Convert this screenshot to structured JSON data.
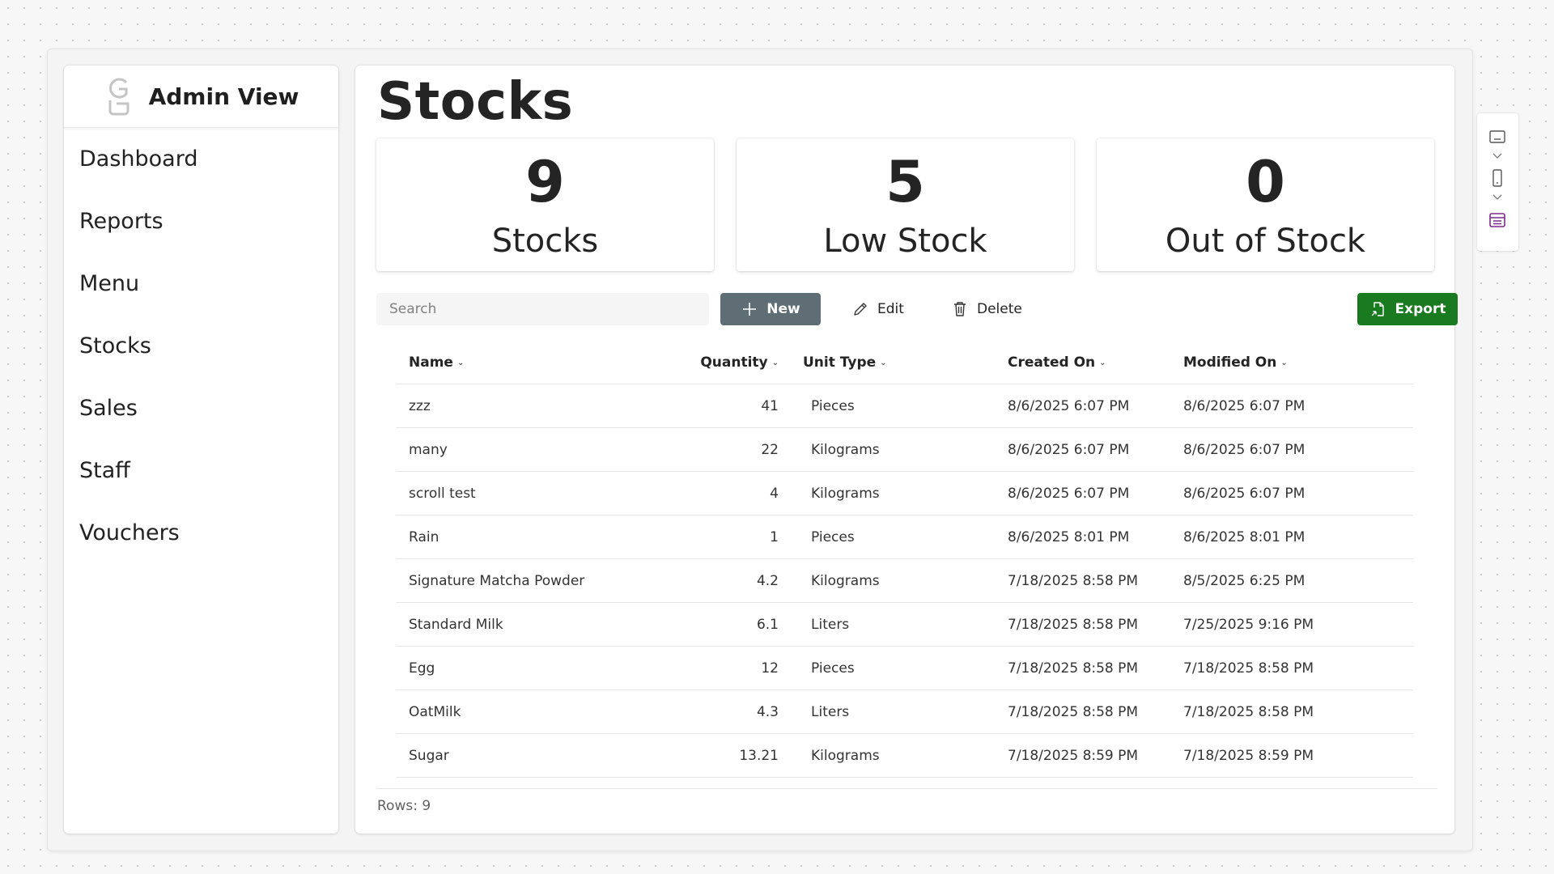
{
  "sidebar": {
    "brand": {
      "title": "Admin View",
      "logo_icon": "g-logo-icon"
    },
    "items": [
      {
        "label": "Dashboard"
      },
      {
        "label": "Reports"
      },
      {
        "label": "Menu"
      },
      {
        "label": "Stocks"
      },
      {
        "label": "Sales"
      },
      {
        "label": "Staff"
      },
      {
        "label": "Vouchers"
      }
    ]
  },
  "page": {
    "title": "Stocks"
  },
  "cards": [
    {
      "value": "9",
      "label": "Stocks"
    },
    {
      "value": "5",
      "label": "Low Stock"
    },
    {
      "value": "0",
      "label": "Out of Stock"
    }
  ],
  "toolbar": {
    "search_placeholder": "Search",
    "new_label": "New",
    "edit_label": "Edit",
    "delete_label": "Delete",
    "export_label": "Export"
  },
  "table": {
    "columns": [
      "Name",
      "Quantity",
      "Unit Type",
      "Created On",
      "Modified On"
    ],
    "rows": [
      {
        "name": "zzz",
        "quantity": "41",
        "unit": "Pieces",
        "created": "8/6/2025 6:07 PM",
        "modified": "8/6/2025 6:07 PM"
      },
      {
        "name": "many",
        "quantity": "22",
        "unit": "Kilograms",
        "created": "8/6/2025 6:07 PM",
        "modified": "8/6/2025 6:07 PM"
      },
      {
        "name": "scroll test",
        "quantity": "4",
        "unit": "Kilograms",
        "created": "8/6/2025 6:07 PM",
        "modified": "8/6/2025 6:07 PM"
      },
      {
        "name": "Rain",
        "quantity": "1",
        "unit": "Pieces",
        "created": "8/6/2025 8:01 PM",
        "modified": "8/6/2025 8:01 PM"
      },
      {
        "name": "Signature Matcha Powder",
        "quantity": "4.2",
        "unit": "Kilograms",
        "created": "7/18/2025 8:58 PM",
        "modified": "8/5/2025 6:25 PM"
      },
      {
        "name": "Standard Milk",
        "quantity": "6.1",
        "unit": "Liters",
        "created": "7/18/2025 8:58 PM",
        "modified": "7/25/2025 9:16 PM"
      },
      {
        "name": "Egg",
        "quantity": "12",
        "unit": "Pieces",
        "created": "7/18/2025 8:58 PM",
        "modified": "7/18/2025 8:58 PM"
      },
      {
        "name": "OatMilk",
        "quantity": "4.3",
        "unit": "Liters",
        "created": "7/18/2025 8:58 PM",
        "modified": "7/18/2025 8:58 PM"
      },
      {
        "name": "Sugar",
        "quantity": "13.21",
        "unit": "Kilograms",
        "created": "7/18/2025 8:59 PM",
        "modified": "7/18/2025 8:59 PM"
      }
    ],
    "rows_count_label": "Rows: 9"
  },
  "colors": {
    "primary_button": "#5f6d75",
    "export_button": "#1a7a1f",
    "rail_active_icon": "#7a2a8c"
  },
  "rail": {
    "icons": [
      "monitor-icon",
      "phone-icon",
      "calendar-icon"
    ]
  }
}
